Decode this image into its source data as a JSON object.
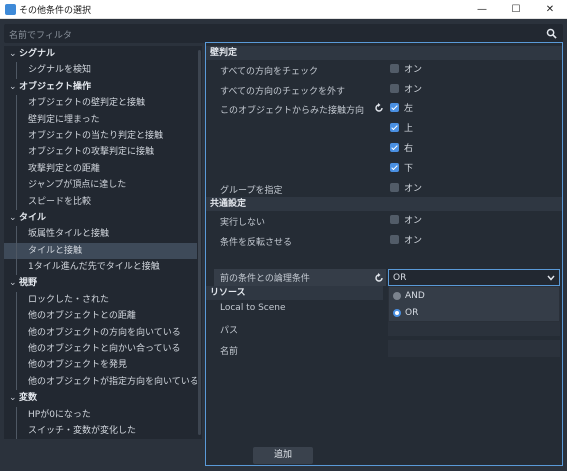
{
  "window": {
    "title": "その他条件の選択",
    "minimize": "—",
    "maximize": "☐",
    "close": "✕"
  },
  "filter": {
    "placeholder": "名前でフィルタ",
    "icon": "search-icon"
  },
  "tree": [
    {
      "type": "cat",
      "label": "シグナル"
    },
    {
      "type": "item",
      "label": "シグナルを検知"
    },
    {
      "type": "cat",
      "label": "オブジェクト操作"
    },
    {
      "type": "item",
      "label": "オブジェクトの壁判定と接触"
    },
    {
      "type": "item",
      "label": "壁判定に埋まった"
    },
    {
      "type": "item",
      "label": "オブジェクトの当たり判定と接触"
    },
    {
      "type": "item",
      "label": "オブジェクトの攻撃判定に接触"
    },
    {
      "type": "item",
      "label": "攻撃判定との距離"
    },
    {
      "type": "item",
      "label": "ジャンプが頂点に達した"
    },
    {
      "type": "item",
      "label": "スピードを比較"
    },
    {
      "type": "cat",
      "label": "タイル"
    },
    {
      "type": "item",
      "label": "坂属性タイルと接触"
    },
    {
      "type": "item",
      "label": "タイルと接触",
      "selected": true
    },
    {
      "type": "item",
      "label": "1タイル進んだ先でタイルと接触"
    },
    {
      "type": "cat",
      "label": "視野"
    },
    {
      "type": "item",
      "label": "ロックした・された"
    },
    {
      "type": "item",
      "label": "他のオブジェクトとの距離"
    },
    {
      "type": "item",
      "label": "他のオブジェクトの方向を向いている"
    },
    {
      "type": "item",
      "label": "他のオブジェクトと向かい合っている"
    },
    {
      "type": "item",
      "label": "他のオブジェクトを発見"
    },
    {
      "type": "item",
      "label": "他のオブジェクトが指定方向を向いている"
    },
    {
      "type": "cat",
      "label": "変数"
    },
    {
      "type": "item",
      "label": "HPが0になった"
    },
    {
      "type": "item",
      "label": "スイッチ・変数が変化した"
    }
  ],
  "inspector": {
    "wall_section": "壁判定",
    "check_all": {
      "label": "すべての方向をチェック",
      "value": "オン"
    },
    "uncheck_all": {
      "label": "すべての方向のチェックを外す",
      "value": "オン"
    },
    "direction": {
      "label": "このオブジェクトからみた接触方向",
      "left": "左",
      "up": "上",
      "right": "右",
      "down": "下"
    },
    "group": {
      "label": "グループを指定",
      "value": "オン"
    },
    "common_section": "共通設定",
    "no_exec": {
      "label": "実行しない",
      "value": "オン"
    },
    "invert": {
      "label": "条件を反転させる",
      "value": "オン"
    },
    "logic": {
      "label": "前の条件との論理条件",
      "value": "OR",
      "options": [
        "AND",
        "OR"
      ]
    },
    "resource_section": "リソース",
    "local_to_scene": "Local to Scene",
    "path": "パス",
    "name": "名前"
  },
  "footer": {
    "add_label": "追加"
  }
}
